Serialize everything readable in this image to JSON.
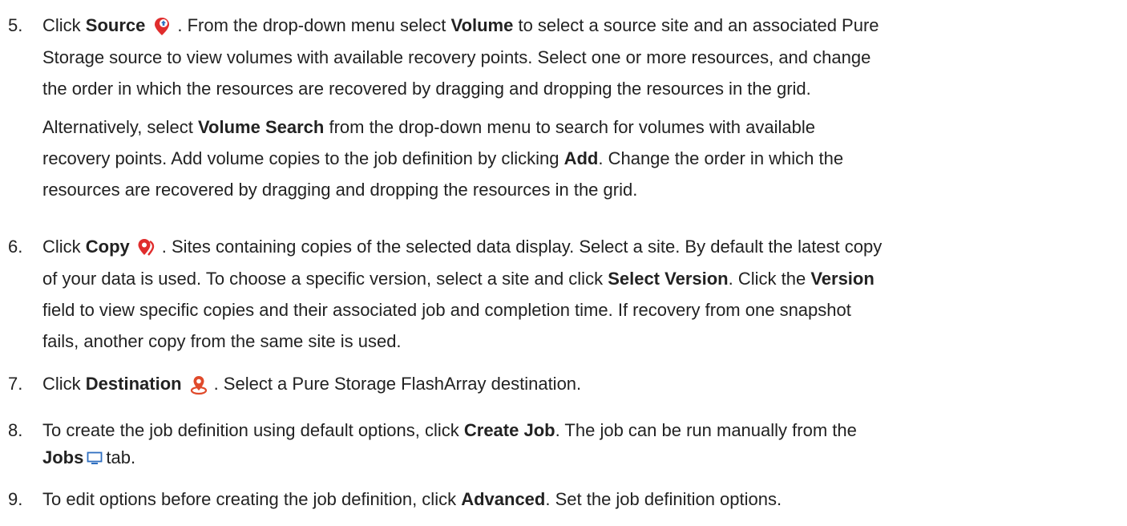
{
  "steps": [
    {
      "number": "5.",
      "lines": [
        {
          "t1": "Click ",
          "b1": "Source",
          "icon": "source-pin-icon",
          "t2": ". From the drop-down menu select ",
          "b2": "Volume",
          "t3": " to select a source site and an associated Pure"
        },
        {
          "t1": "Storage source to view volumes with available recovery points. Select one or more resources, and change"
        },
        {
          "t1": "the order in which the resources are recovered by dragging and dropping the resources in the grid."
        },
        {
          "t1": "Alternatively, select ",
          "b1": "Volume Search",
          "t2": " from the drop-down menu to search for volumes with available"
        },
        {
          "t1": "recovery points. Add volume copies to the job definition by clicking ",
          "b1": "Add",
          "t2": ". Change the order in which the"
        },
        {
          "t1": "resources are recovered by dragging and dropping the resources in the grid."
        }
      ]
    },
    {
      "number": "6.",
      "lines": [
        {
          "t1": "Click ",
          "b1": "Copy",
          "icon": "copy-pin-icon",
          "t2": ". Sites containing copies of the selected data display. Select a site. By default the latest copy"
        },
        {
          "t1": "of your data is used. To choose a specific version, select a site and click ",
          "b1": "Select Version",
          "t2": ". Click the ",
          "b2": "Version"
        },
        {
          "t1": "field to view specific copies and their associated job and completion time. If recovery from one snapshot"
        },
        {
          "t1": "fails, another copy from the same site is used."
        }
      ]
    },
    {
      "number": "7.",
      "lines": [
        {
          "t1": "Click ",
          "b1": "Destination",
          "icon": "destination-pin-icon",
          "t2": ". Select a Pure Storage FlashArray destination."
        }
      ]
    },
    {
      "number": "8.",
      "lines": [
        {
          "t1": "To create the job definition using default options, click ",
          "b1": "Create Job",
          "t2": ". The job can be run manually from the"
        },
        {
          "b1": "Jobs",
          "icon": "monitor-icon",
          "t2": "tab."
        }
      ]
    },
    {
      "number": "9.",
      "lines": [
        {
          "t1": "To edit options before creating the job definition, click ",
          "b1": "Advanced",
          "t2": ". Set the job definition options."
        }
      ]
    }
  ],
  "colors": {
    "text": "#222222",
    "source_icon": "#e02d2d",
    "copy_icon": "#e02d2d",
    "destination_icon": "#e04a2b",
    "monitor_icon": "#2f6fc0"
  }
}
